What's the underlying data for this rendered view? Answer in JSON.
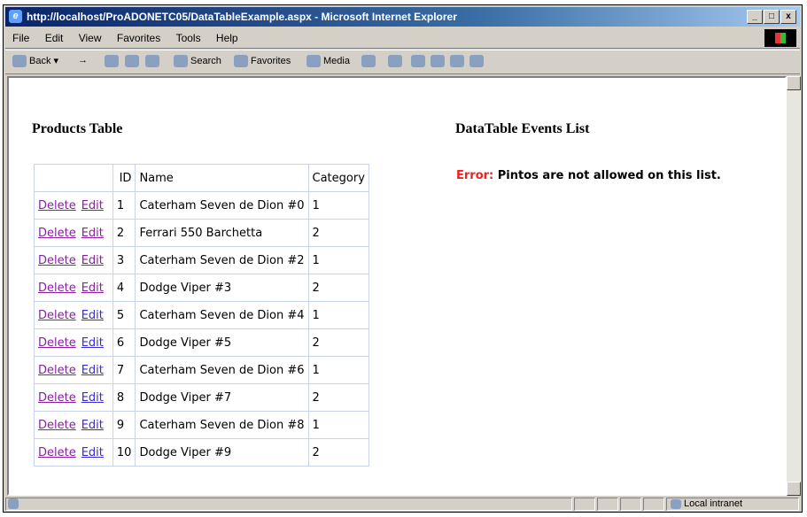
{
  "window": {
    "title": "http://localhost/ProADONETC05/DataTableExample.aspx - Microsoft Internet Explorer",
    "controls": [
      "_",
      "□",
      "x"
    ]
  },
  "menu": [
    "File",
    "Edit",
    "View",
    "Favorites",
    "Tools",
    "Help"
  ],
  "toolbar": {
    "back": "Back",
    "forward": "→",
    "search": "Search",
    "favorites": "Favorites",
    "media": "Media"
  },
  "page": {
    "products_heading": "Products Table",
    "events_heading": "DataTable Events List",
    "error_label": "Error:",
    "error_text": "Pintos are not allowed on this list.",
    "columns": [
      "ID",
      "Name",
      "Category"
    ],
    "delete_label": "Delete",
    "edit_label": "Edit",
    "rows": [
      {
        "id": "1",
        "name": "Caterham Seven de Dion #0",
        "category": "1"
      },
      {
        "id": "2",
        "name": "Ferrari 550 Barchetta",
        "category": "2"
      },
      {
        "id": "3",
        "name": "Caterham Seven de Dion #2",
        "category": "1"
      },
      {
        "id": "4",
        "name": "Dodge Viper #3",
        "category": "2"
      },
      {
        "id": "5",
        "name": "Caterham Seven de Dion #4",
        "category": "1"
      },
      {
        "id": "6",
        "name": "Dodge Viper #5",
        "category": "2"
      },
      {
        "id": "7",
        "name": "Caterham Seven de Dion #6",
        "category": "1"
      },
      {
        "id": "8",
        "name": "Dodge Viper #7",
        "category": "2"
      },
      {
        "id": "9",
        "name": "Caterham Seven de Dion #8",
        "category": "1"
      },
      {
        "id": "10",
        "name": "Dodge Viper #9",
        "category": "2"
      }
    ]
  },
  "status": {
    "zone": "Local intranet"
  }
}
